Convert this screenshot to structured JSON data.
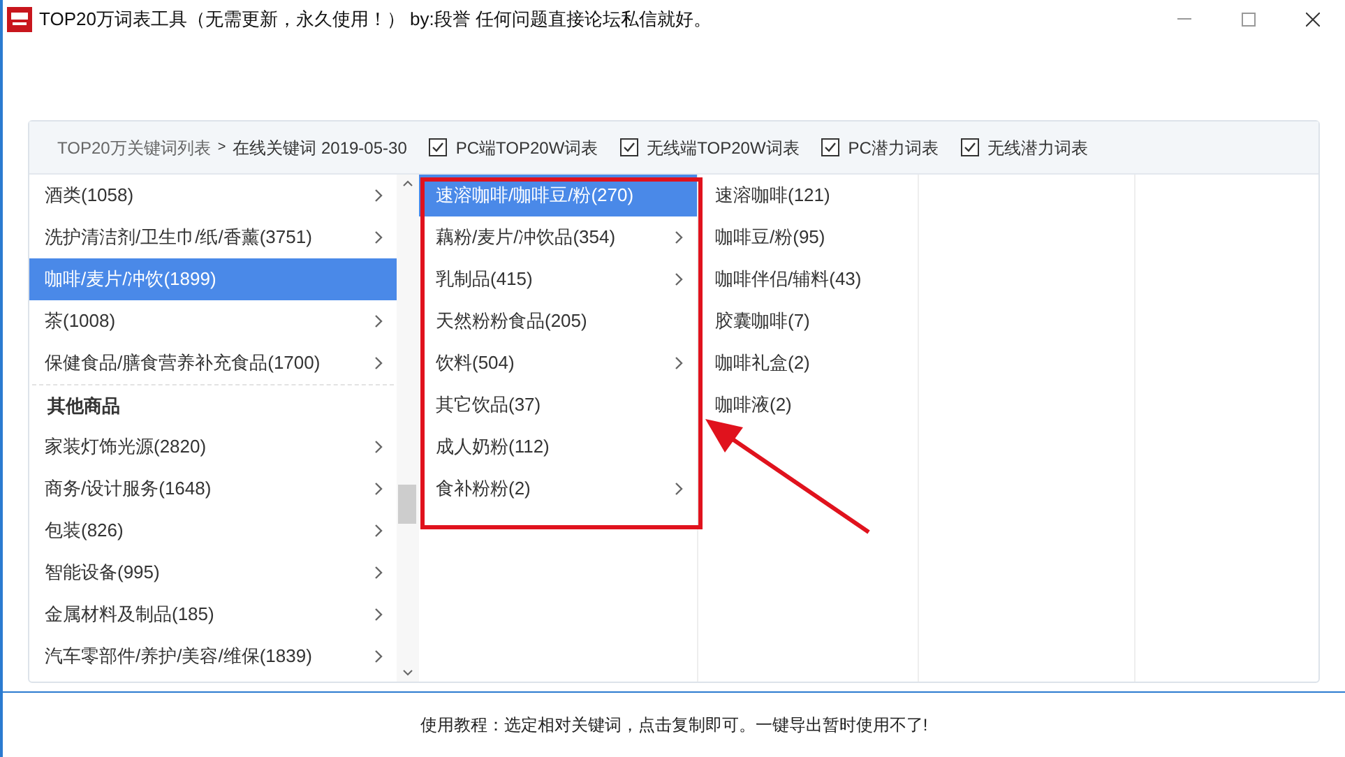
{
  "window": {
    "title": "TOP20万词表工具（无需更新，永久使用！） by:段誉  任何问题直接论坛私信就好。"
  },
  "breadcrumb": {
    "root": "TOP20万关键词列表",
    "separator": ">",
    "current": "在线关键词 2019-05-30"
  },
  "filters": [
    {
      "label": "PC端TOP20W词表",
      "checked": true
    },
    {
      "label": "无线端TOP20W词表",
      "checked": true
    },
    {
      "label": "PC潜力词表",
      "checked": true
    },
    {
      "label": "无线潜力词表",
      "checked": true
    }
  ],
  "categories": [
    {
      "kind": "item",
      "label": "酒类(1058)",
      "selected": false,
      "has_children": true
    },
    {
      "kind": "item",
      "label": "洗护清洁剂/卫生巾/纸/香薰(3751)",
      "selected": false,
      "has_children": true
    },
    {
      "kind": "item",
      "label": "咖啡/麦片/冲饮(1899)",
      "selected": true,
      "has_children": false
    },
    {
      "kind": "item",
      "label": "茶(1008)",
      "selected": false,
      "has_children": true
    },
    {
      "kind": "item",
      "label": "保健食品/膳食营养补充食品(1700)",
      "selected": false,
      "has_children": true
    },
    {
      "kind": "heading",
      "label": "其他商品"
    },
    {
      "kind": "item",
      "label": "家装灯饰光源(2820)",
      "selected": false,
      "has_children": true
    },
    {
      "kind": "item",
      "label": "商务/设计服务(1648)",
      "selected": false,
      "has_children": true
    },
    {
      "kind": "item",
      "label": "包装(826)",
      "selected": false,
      "has_children": true
    },
    {
      "kind": "item",
      "label": "智能设备(995)",
      "selected": false,
      "has_children": true
    },
    {
      "kind": "item",
      "label": "金属材料及制品(185)",
      "selected": false,
      "has_children": true
    },
    {
      "kind": "item",
      "label": "汽车零部件/养护/美容/维保(1839)",
      "selected": false,
      "has_children": true
    }
  ],
  "subcategories": [
    {
      "label": "速溶咖啡/咖啡豆/粉(270)",
      "selected": true,
      "has_children": false
    },
    {
      "label": "藕粉/麦片/冲饮品(354)",
      "selected": false,
      "has_children": true
    },
    {
      "label": "乳制品(415)",
      "selected": false,
      "has_children": true
    },
    {
      "label": "天然粉粉食品(205)",
      "selected": false,
      "has_children": false
    },
    {
      "label": "饮料(504)",
      "selected": false,
      "has_children": true
    },
    {
      "label": "其它饮品(37)",
      "selected": false,
      "has_children": false
    },
    {
      "label": "成人奶粉(112)",
      "selected": false,
      "has_children": false
    },
    {
      "label": "食补粉粉(2)",
      "selected": false,
      "has_children": true
    }
  ],
  "keywords": [
    {
      "label": "速溶咖啡(121)"
    },
    {
      "label": "咖啡豆/粉(95)"
    },
    {
      "label": "咖啡伴侣/辅料(43)"
    },
    {
      "label": "胶囊咖啡(7)"
    },
    {
      "label": "咖啡礼盒(2)"
    },
    {
      "label": "咖啡液(2)"
    }
  ],
  "footer": {
    "text": "使用教程：选定相对关键词，点击复制即可。一键导出暂时使用不了!"
  }
}
